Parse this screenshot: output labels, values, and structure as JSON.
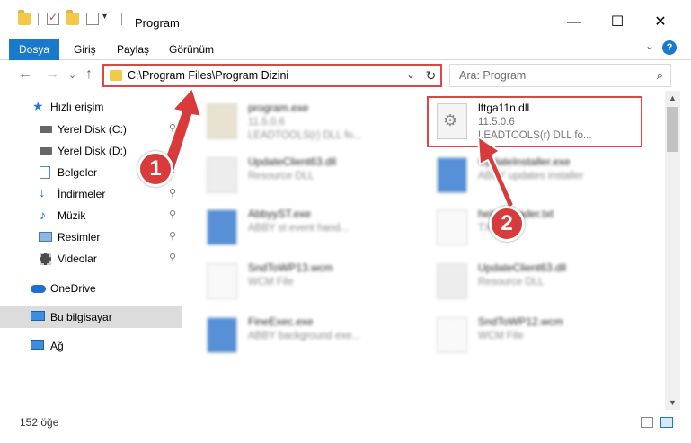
{
  "window": {
    "title": "Program",
    "minimize": "—",
    "maximize": "☐",
    "close": "✕"
  },
  "ribbon": {
    "file_tab": "Dosya",
    "tabs": [
      "Giriş",
      "Paylaş",
      "Görünüm"
    ],
    "expand": "⌄",
    "help": "?"
  },
  "nav": {
    "back": "←",
    "forward": "→",
    "recent": "⌄",
    "up": "↑",
    "address_path": "C:\\Program Files\\Program Dizini",
    "address_dropdown": "⌄",
    "refresh": "↻",
    "search_placeholder": "Ara: Program",
    "search_icon": "⌕"
  },
  "sidebar": {
    "items": [
      {
        "label": "Hızlı erişim",
        "icon": "star-icon",
        "pinned": false
      },
      {
        "label": "Yerel Disk (C:)",
        "icon": "disk-icon",
        "pinned": true
      },
      {
        "label": "Yerel Disk (D:)",
        "icon": "disk-icon",
        "pinned": true
      },
      {
        "label": "Belgeler",
        "icon": "documents-icon",
        "pinned": true
      },
      {
        "label": "İndirmeler",
        "icon": "download-icon",
        "pinned": true
      },
      {
        "label": "Müzik",
        "icon": "music-icon",
        "pinned": true
      },
      {
        "label": "Resimler",
        "icon": "pictures-icon",
        "pinned": true
      },
      {
        "label": "Videolar",
        "icon": "video-icon",
        "pinned": true
      },
      {
        "label": "OneDrive",
        "icon": "cloud-icon",
        "pinned": false
      },
      {
        "label": "Bu bilgisayar",
        "icon": "computer-icon",
        "pinned": false
      },
      {
        "label": "Ağ",
        "icon": "network-icon",
        "pinned": false
      }
    ],
    "pin_glyph": "📌"
  },
  "files": [
    {
      "name": "program.exe",
      "line1": "11.5.0.6",
      "line2": "LEADTOOLS(r) DLL fo...",
      "blurred": true
    },
    {
      "name": "lftga11n.dll",
      "line1": "11.5.0.6",
      "line2": "LEADTOOLS(r) DLL fo...",
      "blurred": false
    },
    {
      "name": "UpdateClient63.dll",
      "line1": "Resource DLL",
      "line2": "",
      "blurred": true
    },
    {
      "name": "UpdateInstaller.exe",
      "line1": "ABBY updates installer",
      "line2": "",
      "blurred": true
    },
    {
      "name": "AbbyyST.exe",
      "line1": "ABBY st event hand...",
      "line2": "",
      "blurred": true
    },
    {
      "name": "help_Reader.txt",
      "line1": "TXT File",
      "line2": "",
      "blurred": true
    },
    {
      "name": "SndToWP13.wcm",
      "line1": "WCM File",
      "line2": "",
      "blurred": true
    },
    {
      "name": "UpdateClient63.dll",
      "line1": "Resource DLL",
      "line2": "",
      "blurred": true
    },
    {
      "name": "FineExec.exe",
      "line1": "ABBY background exe...",
      "line2": "",
      "blurred": true
    },
    {
      "name": "SndToWP12.wcm",
      "line1": "WCM File",
      "line2": "",
      "blurred": true
    }
  ],
  "status": {
    "count": "152 öğe"
  },
  "annotations": {
    "step1": "1",
    "step2": "2",
    "color": "#d83b3b"
  },
  "colors": {
    "accent": "#1979ca",
    "highlight": "#e04444",
    "selected_bg": "#dcdcdc"
  }
}
